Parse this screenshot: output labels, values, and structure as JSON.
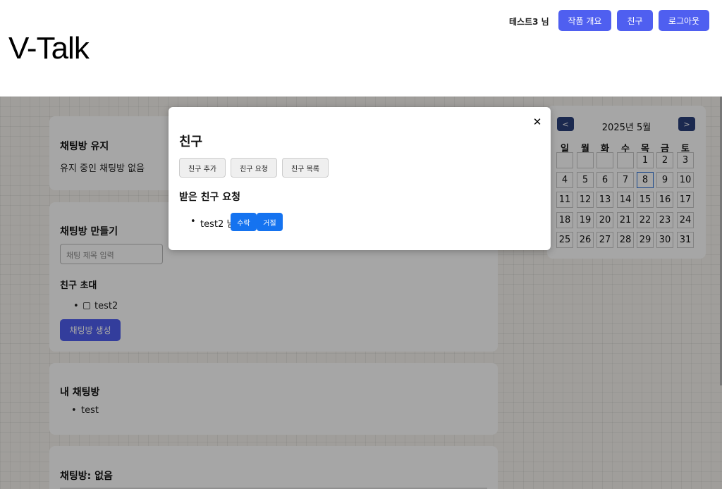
{
  "header": {
    "logo": "V-Talk",
    "user_label": "테스트3 님",
    "buttons": [
      "작품 개요",
      "친구",
      "로그아웃"
    ]
  },
  "keep_room": {
    "title": "채팅방 유지",
    "empty_text": "유지 중인 채팅방 없음"
  },
  "create_room": {
    "title": "채팅방 만들기",
    "input_placeholder": "채팅 제목 입력",
    "invite_title": "친구 초대",
    "friends": [
      "test2"
    ],
    "create_label": "채팅방 생성"
  },
  "my_rooms": {
    "title": "내 채팅방",
    "rooms": [
      "test"
    ]
  },
  "current_room": {
    "title": "채팅방: 없음"
  },
  "calendar": {
    "title": "2025년 5월",
    "prev": "<",
    "next": ">",
    "weekdays": [
      "일",
      "월",
      "화",
      "수",
      "목",
      "금",
      "토"
    ],
    "weeks": [
      [
        "",
        "",
        "",
        "",
        "1",
        "2",
        "3"
      ],
      [
        "4",
        "5",
        "6",
        "7",
        "8",
        "9",
        "10"
      ],
      [
        "11",
        "12",
        "13",
        "14",
        "15",
        "16",
        "17"
      ],
      [
        "18",
        "19",
        "20",
        "21",
        "22",
        "23",
        "24"
      ],
      [
        "25",
        "26",
        "27",
        "28",
        "29",
        "30",
        "31"
      ]
    ],
    "today": "8"
  },
  "modal": {
    "close": "✕",
    "title": "친구",
    "tabs": [
      "친구 추가",
      "친구 요청",
      "친구 목록"
    ],
    "subtitle": "받은 친구 요청",
    "requests": [
      {
        "name": "test2 님",
        "accept": "수락",
        "reject": "거절"
      }
    ]
  }
}
